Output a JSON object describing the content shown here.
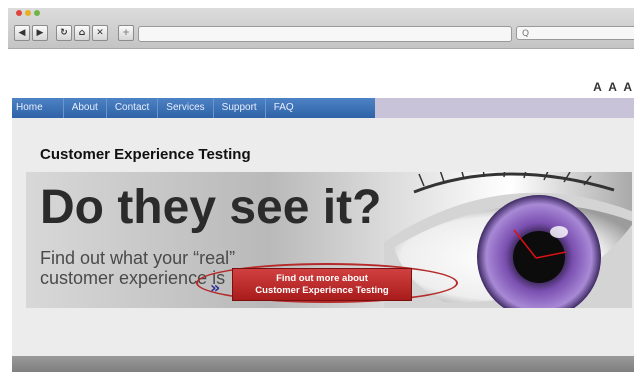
{
  "browser": {
    "nav_icons": [
      "back-icon",
      "forward-icon",
      "reload-icon",
      "home-icon",
      "stop-icon",
      "new-tab-icon"
    ],
    "search_glyph": "Q"
  },
  "page": {
    "font_size_label": "A A A",
    "nav_items": [
      "Home",
      "About",
      "Contact",
      "Services",
      "Support",
      "FAQ"
    ],
    "title": "Customer Experience Testing",
    "banner": {
      "headline": "Do they see it?",
      "subline_1": "Find out what your “real”",
      "subline_2": "customer experience is",
      "cta_line_1": "Find out more about",
      "cta_line_2": "Customer Experience Testing"
    }
  },
  "colors": {
    "nav_blue": "#2f62a7",
    "cta_red": "#b52a2a",
    "eye_purple": "#7a4fb0"
  }
}
